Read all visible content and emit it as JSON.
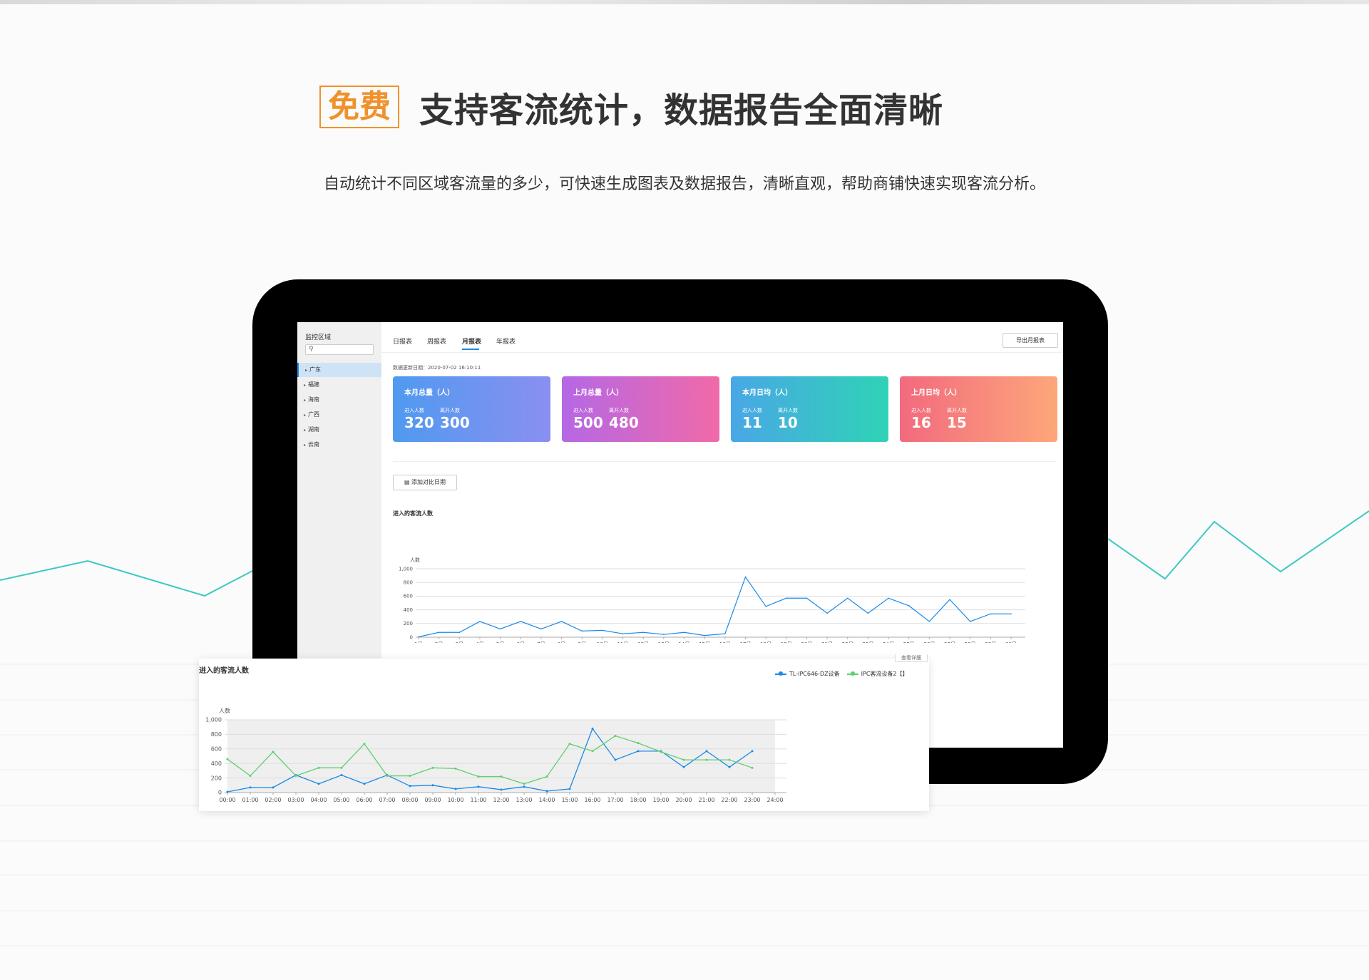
{
  "headline": {
    "badge": "免费",
    "title": "支持客流统计，数据报告全面清晰",
    "subtitle": "自动统计不同区域客流量的多少，可快速生成图表及数据报告，清晰直观，帮助商铺快速实现客流分析。"
  },
  "sidebar": {
    "title": "监控区域",
    "search_placeholder": "",
    "items": [
      {
        "label": "广东",
        "active": true
      },
      {
        "label": "福建"
      },
      {
        "label": "海南"
      },
      {
        "label": "广西"
      },
      {
        "label": "湖南"
      },
      {
        "label": "云南"
      }
    ]
  },
  "tabs": [
    {
      "label": "日报表"
    },
    {
      "label": "周报表"
    },
    {
      "label": "月报表",
      "active": true
    },
    {
      "label": "年报表"
    }
  ],
  "export_button": "导出月报表",
  "updated_text": "数据更新日期：2020-07-02 16:10:11",
  "cards": [
    {
      "title": "本月总量（人）",
      "in_label": "进入人数",
      "out_label": "离开人数",
      "in_value": "320",
      "out_value": "300",
      "gradient": [
        "#4f9af0",
        "#8a8ff0"
      ]
    },
    {
      "title": "上月总量（人）",
      "in_label": "进入人数",
      "out_label": "离开人数",
      "in_value": "500",
      "out_value": "480",
      "gradient": [
        "#b567e6",
        "#f06aa8"
      ]
    },
    {
      "title": "本月日均（人）",
      "in_label": "进入人数",
      "out_label": "离开人数",
      "in_value": "11",
      "out_value": "10",
      "gradient": [
        "#49a7e6",
        "#2fd3b6"
      ]
    },
    {
      "title": "上月日均（人）",
      "in_label": "进入人数",
      "out_label": "离开人数",
      "in_value": "16",
      "out_value": "15",
      "gradient": [
        "#f26a7e",
        "#fda77a"
      ]
    }
  ],
  "compare_button": "添加对比日期",
  "colors": {
    "series_blue": "#1a8ae8",
    "series_green": "#5fcf6e",
    "badge_orange": "#f0922c",
    "bg_line": "#3cc9c2"
  },
  "chart_data": [
    {
      "type": "line",
      "title": "进入的客流人数",
      "ylabel": "人数",
      "ylim": [
        0,
        1000
      ],
      "yticks": [
        "0",
        "200",
        "400",
        "600",
        "800",
        "1,000"
      ],
      "categories": [
        "1日",
        "2日",
        "3日",
        "4日",
        "5日",
        "6日",
        "7日",
        "8日",
        "9日",
        "10日",
        "11日",
        "12日",
        "13日",
        "14日",
        "15日",
        "16日",
        "17日",
        "18日",
        "19日",
        "20日",
        "21日",
        "22日",
        "23日",
        "24日",
        "25日",
        "26日",
        "27日",
        "28日",
        "29日",
        "30日"
      ],
      "series": [
        {
          "values": [
            5,
            70,
            70,
            230,
            120,
            230,
            120,
            230,
            90,
            100,
            50,
            70,
            40,
            70,
            25,
            50,
            880,
            450,
            570,
            570,
            350,
            570,
            350,
            570,
            460,
            230,
            550,
            230,
            340,
            340
          ],
          "color": "#1a8ae8"
        }
      ],
      "grid": true
    },
    {
      "type": "line",
      "title": "进入的客流人数",
      "ylabel": "人数",
      "ylim": [
        0,
        1000
      ],
      "yticks": [
        "0",
        "200",
        "400",
        "600",
        "800",
        "1,000"
      ],
      "categories": [
        "00:00",
        "01:00",
        "02:00",
        "03:00",
        "04:00",
        "05:00",
        "06:00",
        "07:00",
        "08:00",
        "09:00",
        "10:00",
        "11:00",
        "12:00",
        "13:00",
        "14:00",
        "15:00",
        "16:00",
        "17:00",
        "18:00",
        "19:00",
        "20:00",
        "21:00",
        "22:00",
        "23:00",
        "24:00"
      ],
      "series": [
        {
          "name": "TL-IPC646-DZ设备",
          "values": [
            10,
            70,
            70,
            240,
            120,
            240,
            120,
            240,
            90,
            100,
            50,
            80,
            40,
            80,
            20,
            50,
            880,
            450,
            570,
            570,
            350,
            570,
            350,
            570
          ],
          "color": "#1a8ae8"
        },
        {
          "name": "IPC客流设备2【】",
          "values": [
            460,
            230,
            560,
            230,
            340,
            340,
            670,
            230,
            230,
            340,
            330,
            220,
            220,
            120,
            220,
            670,
            570,
            780,
            680,
            560,
            450,
            450,
            450,
            340
          ],
          "color": "#5fcf6e"
        }
      ],
      "grid": true,
      "legend": "top-right"
    }
  ],
  "panel_tab": "查看详细"
}
